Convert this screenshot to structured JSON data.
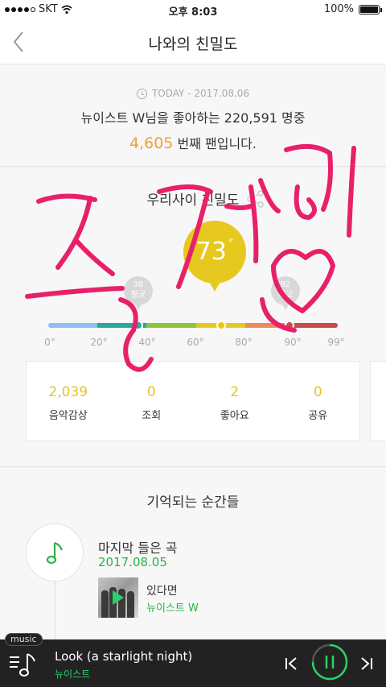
{
  "status_bar": {
    "carrier": "SKT",
    "time": "오후 8:03",
    "battery": "100%",
    "battery_level": 1.0
  },
  "nav": {
    "title": "나와의 친밀도"
  },
  "ranking": {
    "today_label": "TODAY - 2017.08.06",
    "line1": "뉴이스트 W님을 좋아하는 220,591 명중",
    "rank_number": "4,605",
    "rank_suffix": "번째 팬입니다."
  },
  "intimacy": {
    "title": "우리사이 친밀도",
    "score": "73",
    "score_value": 73,
    "average": {
      "value": "38",
      "label": "평균",
      "position": 38
    },
    "max": {
      "value": "92",
      "label": "최고",
      "position": 92
    },
    "ticks": [
      "0°",
      "20°",
      "40°",
      "60°",
      "80°",
      "90°",
      "99°"
    ],
    "segments": [
      {
        "color": "#8cc0f0",
        "portion": 0.17
      },
      {
        "color": "#2aa89a",
        "portion": 0.17
      },
      {
        "color": "#8cc63e",
        "portion": 0.17
      },
      {
        "color": "#e6c81e",
        "portion": 0.17
      },
      {
        "color": "#f08a5a",
        "portion": 0.16
      },
      {
        "color": "#c94b4b",
        "portion": 0.16
      }
    ],
    "stats": [
      {
        "value": "2,039",
        "label": "음악감상"
      },
      {
        "value": "0",
        "label": "조회"
      },
      {
        "value": "2",
        "label": "좋아요"
      },
      {
        "value": "0",
        "label": "공유"
      }
    ]
  },
  "moments": {
    "title": "기억되는 순간들",
    "item_title": "마지막 들은 곡",
    "item_date": "2017.08.05",
    "song": "있다면",
    "artist": "뉴이스트 W"
  },
  "player": {
    "badge": "music",
    "title": "Look (a starlight night)",
    "artist": "뉴이스트",
    "progress": 0.75
  },
  "colors": {
    "accent_yellow": "#e6c81e",
    "green": "#2bb24c",
    "orange": "#f0a030",
    "scribble_pink": "#e8206a"
  }
}
